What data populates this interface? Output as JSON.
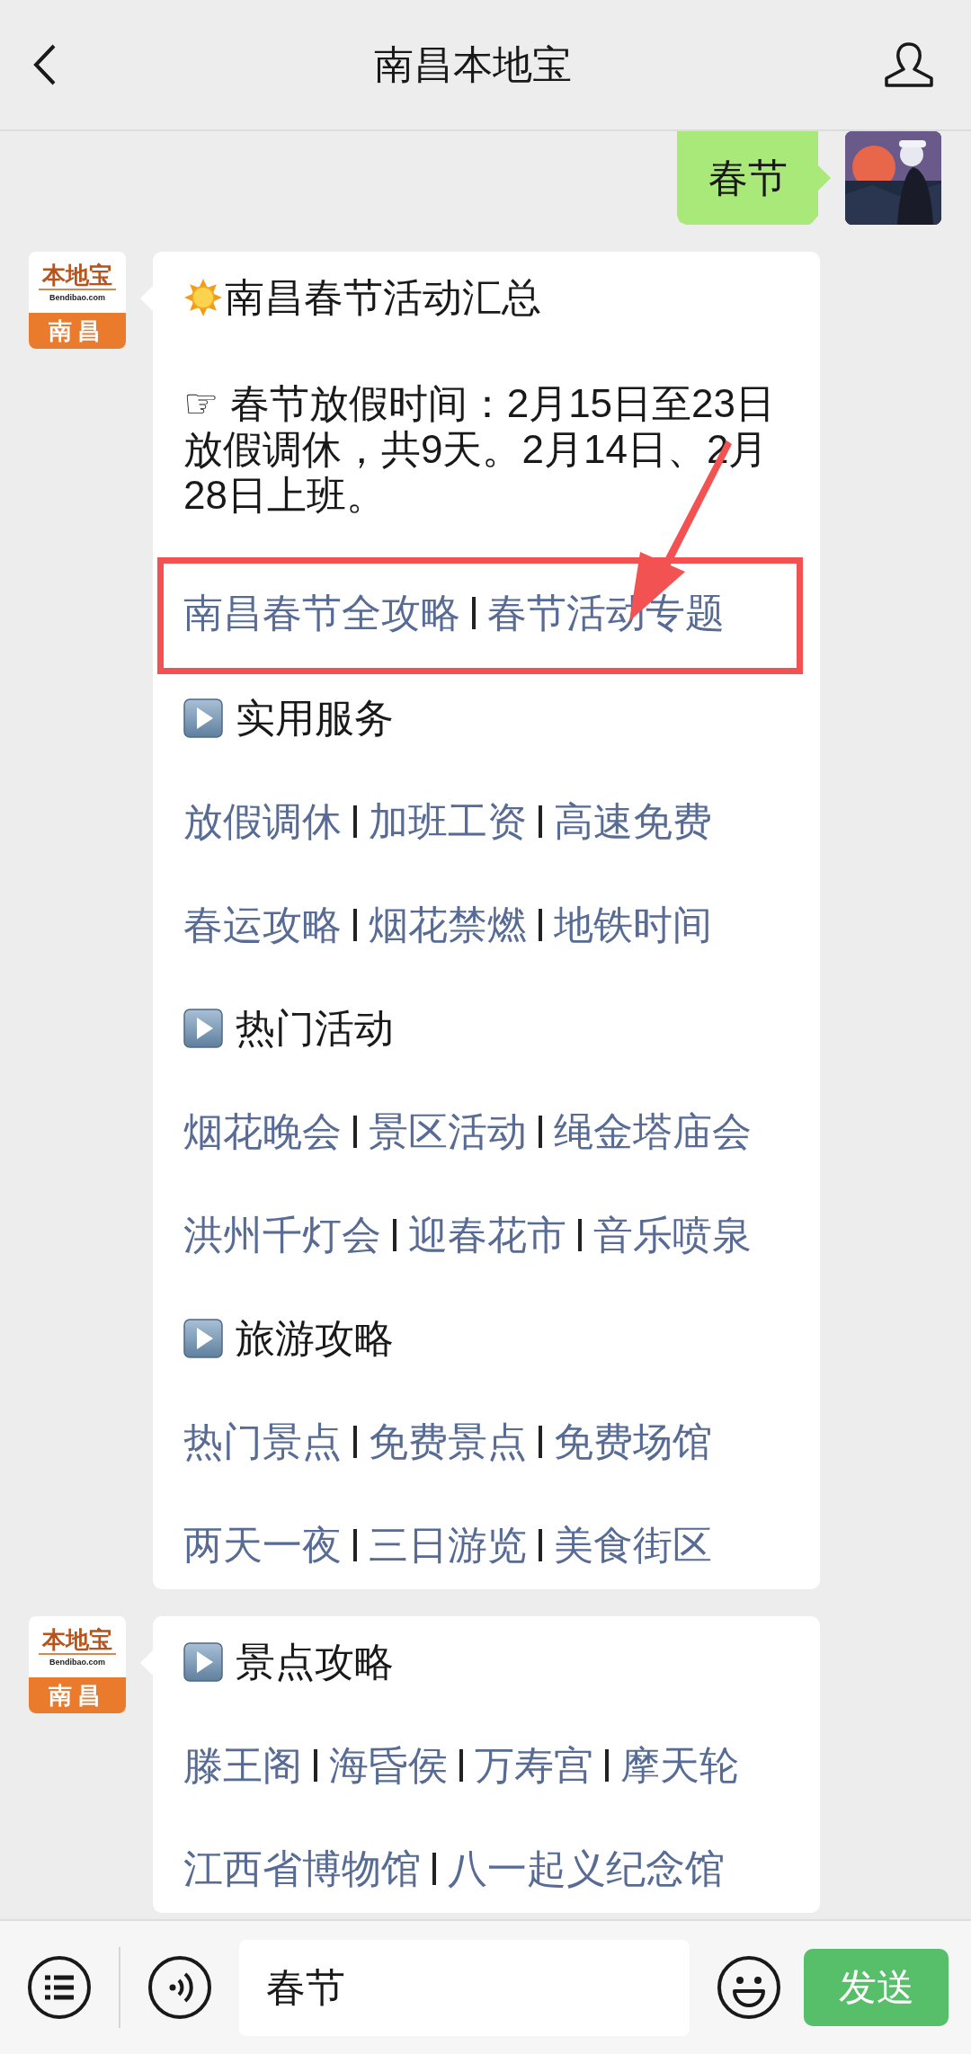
{
  "header": {
    "title": "南昌本地宝"
  },
  "messages": [
    {
      "kind": "sent",
      "text": "春节"
    },
    {
      "kind": "received",
      "logo": {
        "brand": "本地宝",
        "domain": "Bendibao.com",
        "city": "南昌"
      },
      "blocks": [
        {
          "kind": "title",
          "text": "南昌春节活动汇总"
        },
        {
          "kind": "paragraph",
          "text": "☞ 春节放假时间：2月15日至23日放假调休，共9天。2月14日、2月28日上班。"
        },
        {
          "kind": "links",
          "highlighted": true,
          "links": [
            "南昌春节全攻略",
            "春节活动专题"
          ]
        },
        {
          "kind": "section",
          "text": "实用服务"
        },
        {
          "kind": "links",
          "highlighted": false,
          "links": [
            "放假调休",
            "加班工资",
            "高速免费"
          ]
        },
        {
          "kind": "links",
          "highlighted": false,
          "links": [
            "春运攻略",
            "烟花禁燃",
            "地铁时间"
          ]
        },
        {
          "kind": "section",
          "text": "热门活动"
        },
        {
          "kind": "links",
          "highlighted": false,
          "links": [
            "烟花晚会",
            "景区活动",
            "绳金塔庙会"
          ]
        },
        {
          "kind": "links",
          "highlighted": false,
          "links": [
            "洪州千灯会",
            "迎春花市",
            "音乐喷泉"
          ]
        },
        {
          "kind": "section",
          "text": "旅游攻略"
        },
        {
          "kind": "links",
          "highlighted": false,
          "links": [
            "热门景点",
            "免费景点",
            "免费场馆"
          ]
        },
        {
          "kind": "links",
          "highlighted": false,
          "links": [
            "两天一夜",
            "三日游览",
            "美食街区"
          ]
        }
      ]
    },
    {
      "kind": "received",
      "logo": {
        "brand": "本地宝",
        "domain": "Bendibao.com",
        "city": "南昌"
      },
      "blocks": [
        {
          "kind": "section",
          "text": "景点攻略"
        },
        {
          "kind": "links",
          "highlighted": false,
          "links": [
            "滕王阁",
            "海昏侯",
            "万寿宫",
            "摩天轮"
          ]
        },
        {
          "kind": "links",
          "highlighted": false,
          "links": [
            "江西省博物馆",
            "八一起义纪念馆"
          ]
        }
      ]
    }
  ],
  "input_bar": {
    "value": "春节",
    "send_label": "发送"
  }
}
